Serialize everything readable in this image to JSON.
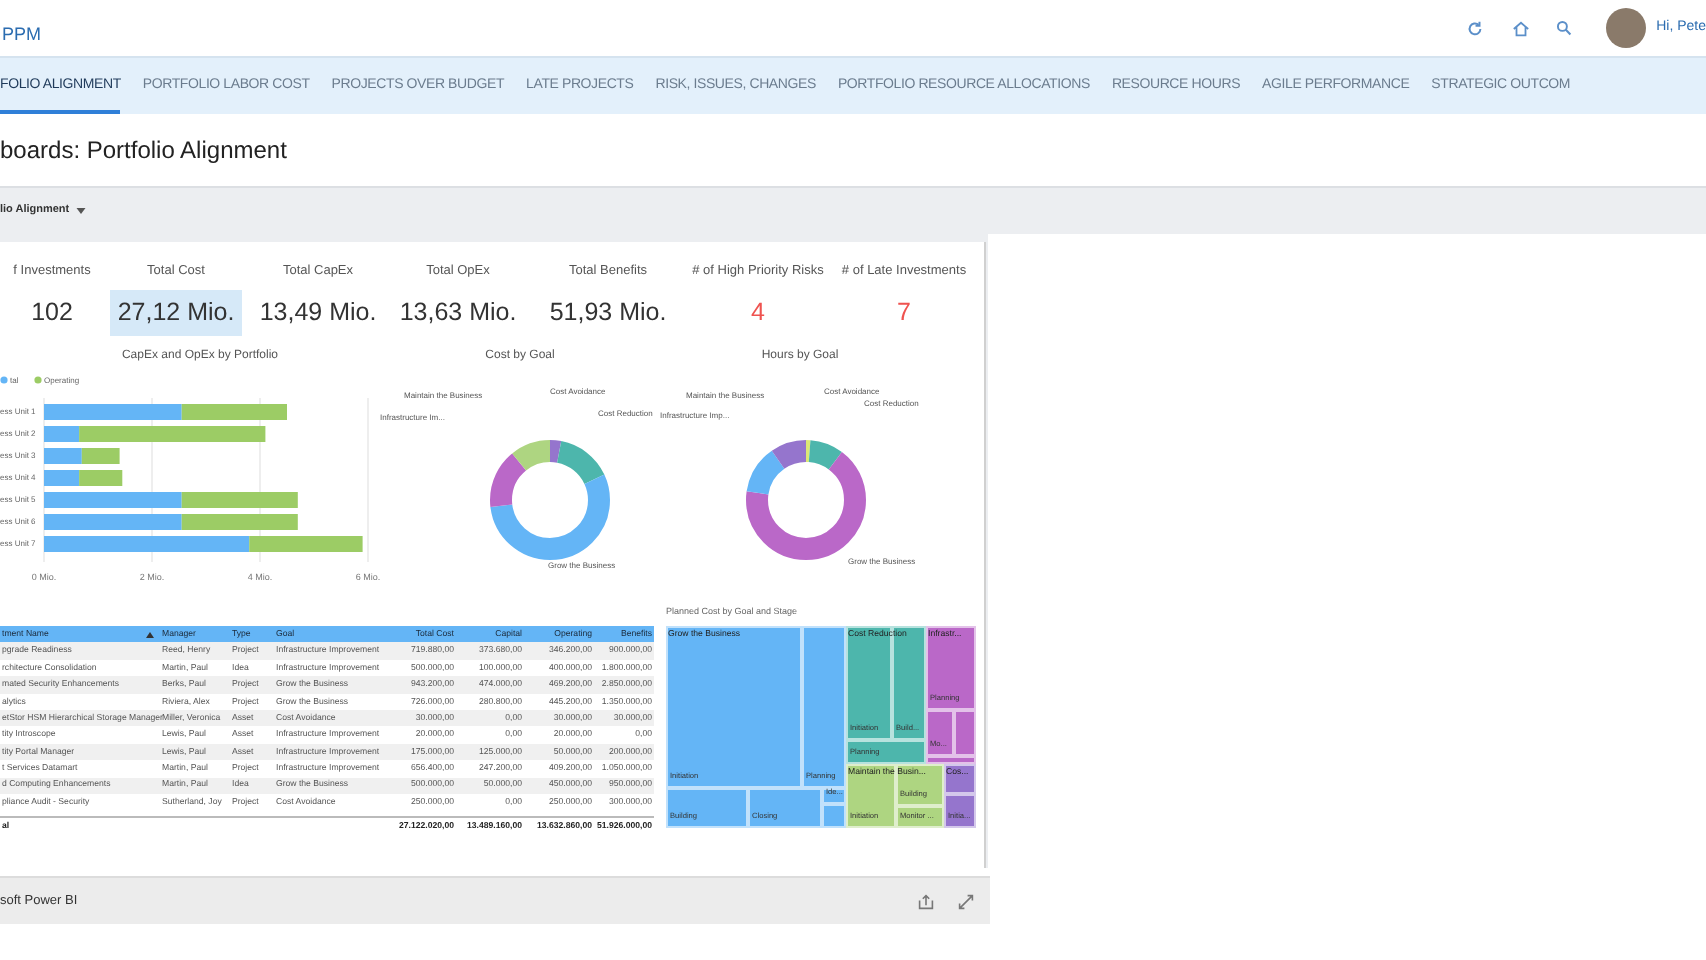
{
  "app": {
    "title": "PPM",
    "greeting": "Hi, Pete"
  },
  "tabs": [
    {
      "label": "FOLIO ALIGNMENT",
      "selected": true
    },
    {
      "label": "PORTFOLIO LABOR COST",
      "selected": false
    },
    {
      "label": "PROJECTS OVER BUDGET",
      "selected": false
    },
    {
      "label": "LATE PROJECTS",
      "selected": false
    },
    {
      "label": "RISK, ISSUES, CHANGES",
      "selected": false
    },
    {
      "label": "PORTFOLIO RESOURCE ALLOCATIONS",
      "selected": false
    },
    {
      "label": "RESOURCE HOURS",
      "selected": false
    },
    {
      "label": "AGILE PERFORMANCE",
      "selected": false
    },
    {
      "label": "STRATEGIC OUTCOM",
      "selected": false
    }
  ],
  "page_title": "boards: Portfolio Alignment",
  "report_selector": "lio Alignment",
  "kpis": [
    {
      "label": "f Investments",
      "value": "102",
      "highlighted": false,
      "alert": false
    },
    {
      "label": "Total Cost",
      "value": "27,12 Mio.",
      "highlighted": true,
      "alert": false
    },
    {
      "label": "Total CapEx",
      "value": "13,49 Mio.",
      "highlighted": false,
      "alert": false
    },
    {
      "label": "Total OpEx",
      "value": "13,63 Mio.",
      "highlighted": false,
      "alert": false
    },
    {
      "label": "Total Benefits",
      "value": "51,93 Mio.",
      "highlighted": false,
      "alert": false
    },
    {
      "label": "# of High Priority Risks",
      "value": "4",
      "highlighted": false,
      "alert": true
    },
    {
      "label": "# of Late Investments",
      "value": "7",
      "highlighted": false,
      "alert": true
    }
  ],
  "bar_chart": {
    "chart_data": {
      "type": "bar",
      "title": "CapEx and OpEx by Portfolio",
      "orientation": "horizontal",
      "stacked": true,
      "legend": "top-left",
      "categories": [
        "ess Unit 1",
        "ess Unit 2",
        "ess Unit 3",
        "ess Unit 4",
        "ess Unit 5",
        "ess Unit 6",
        "ess Unit 7"
      ],
      "series": [
        {
          "name": "tal",
          "color": "#64b5f6",
          "values": [
            2.55,
            0.65,
            0.7,
            0.65,
            2.55,
            2.55,
            3.8
          ]
        },
        {
          "name": "Operating",
          "color": "#9ccc65",
          "values": [
            1.95,
            3.45,
            0.7,
            0.8,
            2.15,
            2.15,
            2.1
          ]
        }
      ],
      "xlim": [
        0,
        6
      ],
      "xticks": [
        {
          "value": 0,
          "label": "0 Mio."
        },
        {
          "value": 2,
          "label": "2 Mio."
        },
        {
          "value": 4,
          "label": "4 Mio."
        },
        {
          "value": 6,
          "label": "6 Mio."
        }
      ]
    }
  },
  "donuts": [
    {
      "title": "Cost by Goal",
      "segments": [
        {
          "label": "Cost Avoidance",
          "color": "#9575cd"
        },
        {
          "label": "Cost Reduction",
          "color": "#4db6ac"
        },
        {
          "label": "Grow the Business",
          "color": "#64b5f6"
        },
        {
          "label": "Infrastructure Im...",
          "color": "#ba68c8"
        },
        {
          "label": "Maintain the Business",
          "color": "#aed581"
        }
      ]
    },
    {
      "title": "Hours by Goal",
      "segments": [
        {
          "label": "Cost Avoidance",
          "color": "#dce775"
        },
        {
          "label": "Cost Reduction",
          "color": "#4db6ac"
        },
        {
          "label": "Grow the Business",
          "color": "#ba68c8"
        },
        {
          "label": "Infrastructure Imp...",
          "color": "#64b5f6"
        },
        {
          "label": "Maintain the Business",
          "color": "#9575cd"
        }
      ]
    }
  ],
  "table": {
    "columns": [
      "tment Name",
      "Manager",
      "Type",
      "Goal",
      "Total Cost",
      "Capital",
      "Operating",
      "Benefits"
    ],
    "rows": [
      [
        "pgrade Readiness",
        "Reed, Henry",
        "Project",
        "Infrastructure Improvement",
        "719.880,00",
        "373.680,00",
        "346.200,00",
        "900.000,00"
      ],
      [
        "rchitecture Consolidation",
        "Martin, Paul",
        "Idea",
        "Infrastructure Improvement",
        "500.000,00",
        "100.000,00",
        "400.000,00",
        "1.800.000,00"
      ],
      [
        "mated Security Enhancements",
        "Berks, Paul",
        "Project",
        "Grow the Business",
        "943.200,00",
        "474.000,00",
        "469.200,00",
        "2.850.000,00"
      ],
      [
        "alytics",
        "Riviera, Alex",
        "Project",
        "Grow the Business",
        "726.000,00",
        "280.800,00",
        "445.200,00",
        "1.350.000,00"
      ],
      [
        "etStor HSM Hierarchical Storage Manager",
        "Miller, Veronica",
        "Asset",
        "Cost Avoidance",
        "30.000,00",
        "0,00",
        "30.000,00",
        "30.000,00"
      ],
      [
        "tity Introscope",
        "Lewis, Paul",
        "Asset",
        "Infrastructure Improvement",
        "20.000,00",
        "0,00",
        "20.000,00",
        "0,00"
      ],
      [
        "tity Portal Manager",
        "Lewis, Paul",
        "Asset",
        "Infrastructure Improvement",
        "175.000,00",
        "125.000,00",
        "50.000,00",
        "200.000,00"
      ],
      [
        "t Services Datamart",
        "Martin, Paul",
        "Project",
        "Infrastructure Improvement",
        "656.400,00",
        "247.200,00",
        "409.200,00",
        "1.050.000,00"
      ],
      [
        "d Computing Enhancements",
        "Martin, Paul",
        "Idea",
        "Grow the Business",
        "500.000,00",
        "50.000,00",
        "450.000,00",
        "950.000,00"
      ],
      [
        "pliance Audit - Security",
        "Sutherland, Joy",
        "Project",
        "Cost Avoidance",
        "250.000,00",
        "0,00",
        "250.000,00",
        "300.000,00"
      ]
    ],
    "total": {
      "label": "al",
      "total_cost": "27.122.020,00",
      "capital": "13.489.160,00",
      "operating": "13.632.860,00",
      "benefits": "51.926.000,00"
    }
  },
  "treemap": {
    "title": "Planned Cost by Goal and Stage",
    "groups": [
      {
        "name": "Grow the Business",
        "color": "#64b5f6",
        "tiles": [
          "Initiation",
          "Planning",
          "Building",
          "Closing",
          "Ide..."
        ]
      },
      {
        "name": "Cost Reduction",
        "color": "#4db6ac",
        "tiles": [
          "Initiation",
          "Build...",
          "Planning"
        ]
      },
      {
        "name": "Infrastr...",
        "color": "#ba68c8",
        "tiles": [
          "Planning",
          "Mo..."
        ]
      },
      {
        "name": "Maintain the Busin...",
        "color": "#aed581",
        "tiles": [
          "Initiation",
          "Building",
          "Monitor ..."
        ]
      },
      {
        "name": "Cos...",
        "color": "#9575cd",
        "tiles": [
          "Initia..."
        ]
      }
    ]
  },
  "footer": {
    "label": "soft Power BI"
  }
}
